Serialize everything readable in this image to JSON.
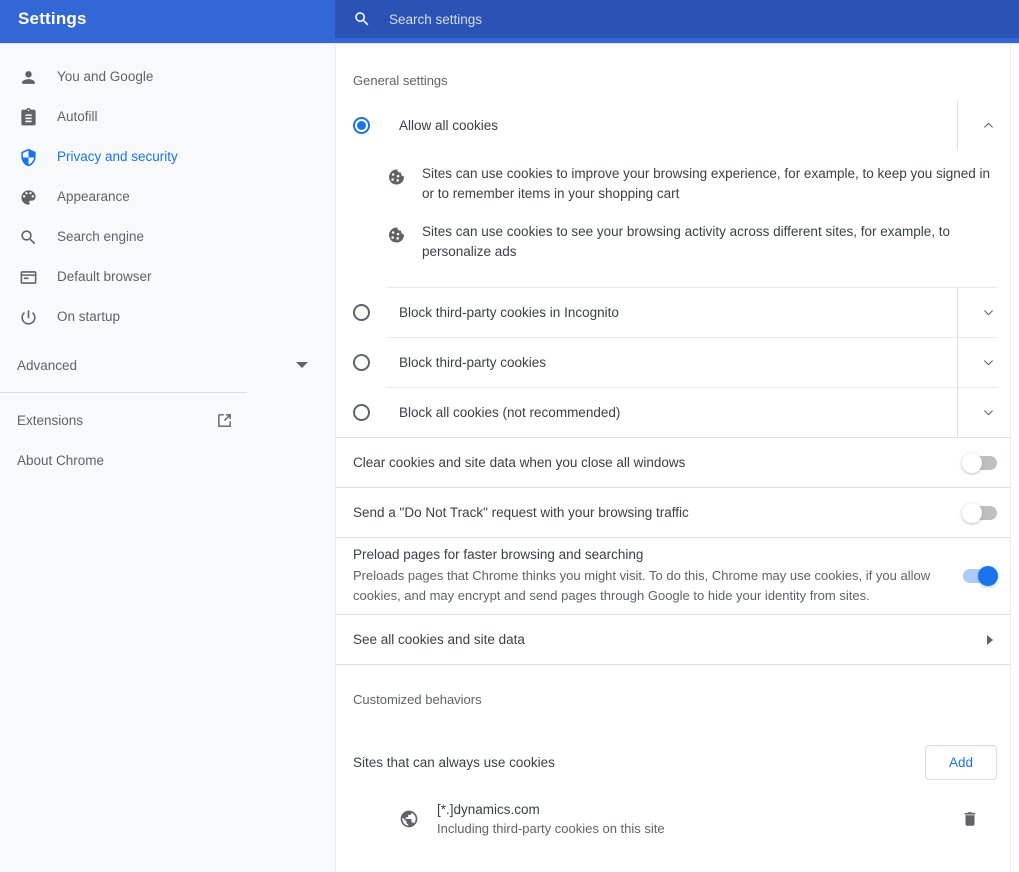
{
  "header": {
    "title": "Settings",
    "search_placeholder": "Search settings",
    "search_value": "",
    "search_icon": "search-icon",
    "bg_color": "#3367d6",
    "search_bg_color": "#2a53b5"
  },
  "sidebar": {
    "items": [
      {
        "label": "You and Google",
        "icon": "person-icon",
        "active": false
      },
      {
        "label": "Autofill",
        "icon": "clipboard-icon",
        "active": false
      },
      {
        "label": "Privacy and security",
        "icon": "shield-icon",
        "active": true
      },
      {
        "label": "Appearance",
        "icon": "palette-icon",
        "active": false
      },
      {
        "label": "Search engine",
        "icon": "search-icon",
        "active": false
      },
      {
        "label": "Default browser",
        "icon": "browser-window-icon",
        "active": false
      },
      {
        "label": "On startup",
        "icon": "power-icon",
        "active": false
      }
    ],
    "advanced": {
      "label": "Advanced",
      "icon": "caret-down-icon"
    },
    "extensions": {
      "label": "Extensions",
      "icon": "external-link-icon"
    },
    "about": {
      "label": "About Chrome"
    },
    "active_color": "#1a73e8",
    "text_color": "#5f6368",
    "bg_color": "#f8f9fa"
  },
  "main": {
    "general_settings_title": "General settings",
    "cookie_options": [
      {
        "label": "Allow all cookies",
        "selected": true,
        "expanded": true,
        "chevron": "chevron-up-icon",
        "details": [
          {
            "icon": "cookie-icon",
            "text": "Sites can use cookies to improve your browsing experience, for example, to keep you signed in or to remember items in your shopping cart"
          },
          {
            "icon": "cookie-icon",
            "text": "Sites can use cookies to see your browsing activity across different sites, for example, to personalize ads"
          }
        ]
      },
      {
        "label": "Block third-party cookies in Incognito",
        "selected": false,
        "expanded": false,
        "chevron": "chevron-down-icon",
        "details": []
      },
      {
        "label": "Block third-party cookies",
        "selected": false,
        "expanded": false,
        "chevron": "chevron-down-icon",
        "details": []
      },
      {
        "label": "Block all cookies (not recommended)",
        "selected": false,
        "expanded": false,
        "chevron": "chevron-down-icon",
        "details": []
      }
    ],
    "toggles": [
      {
        "title": "Clear cookies and site data when you close all windows",
        "subtitle": "",
        "on": false
      },
      {
        "title": "Send a \"Do Not Track\" request with your browsing traffic",
        "subtitle": "",
        "on": false
      },
      {
        "title": "Preload pages for faster browsing and searching",
        "subtitle": "Preloads pages that Chrome thinks you might visit. To do this, Chrome may use cookies, if you allow cookies, and may encrypt and send pages through Google to hide your identity from sites.",
        "on": true
      }
    ],
    "see_all_cookies": {
      "label": "See all cookies and site data",
      "arrow": "triangle-right-icon"
    },
    "customized_behaviors_title": "Customized behaviors",
    "sites_always_allow": {
      "label": "Sites that can always use cookies",
      "add_label": "Add",
      "entries": [
        {
          "icon": "globe-icon",
          "name": "[*.]dynamics.com",
          "sub": "Including third-party cookies on this site",
          "delete_icon": "trash-icon"
        }
      ]
    }
  }
}
